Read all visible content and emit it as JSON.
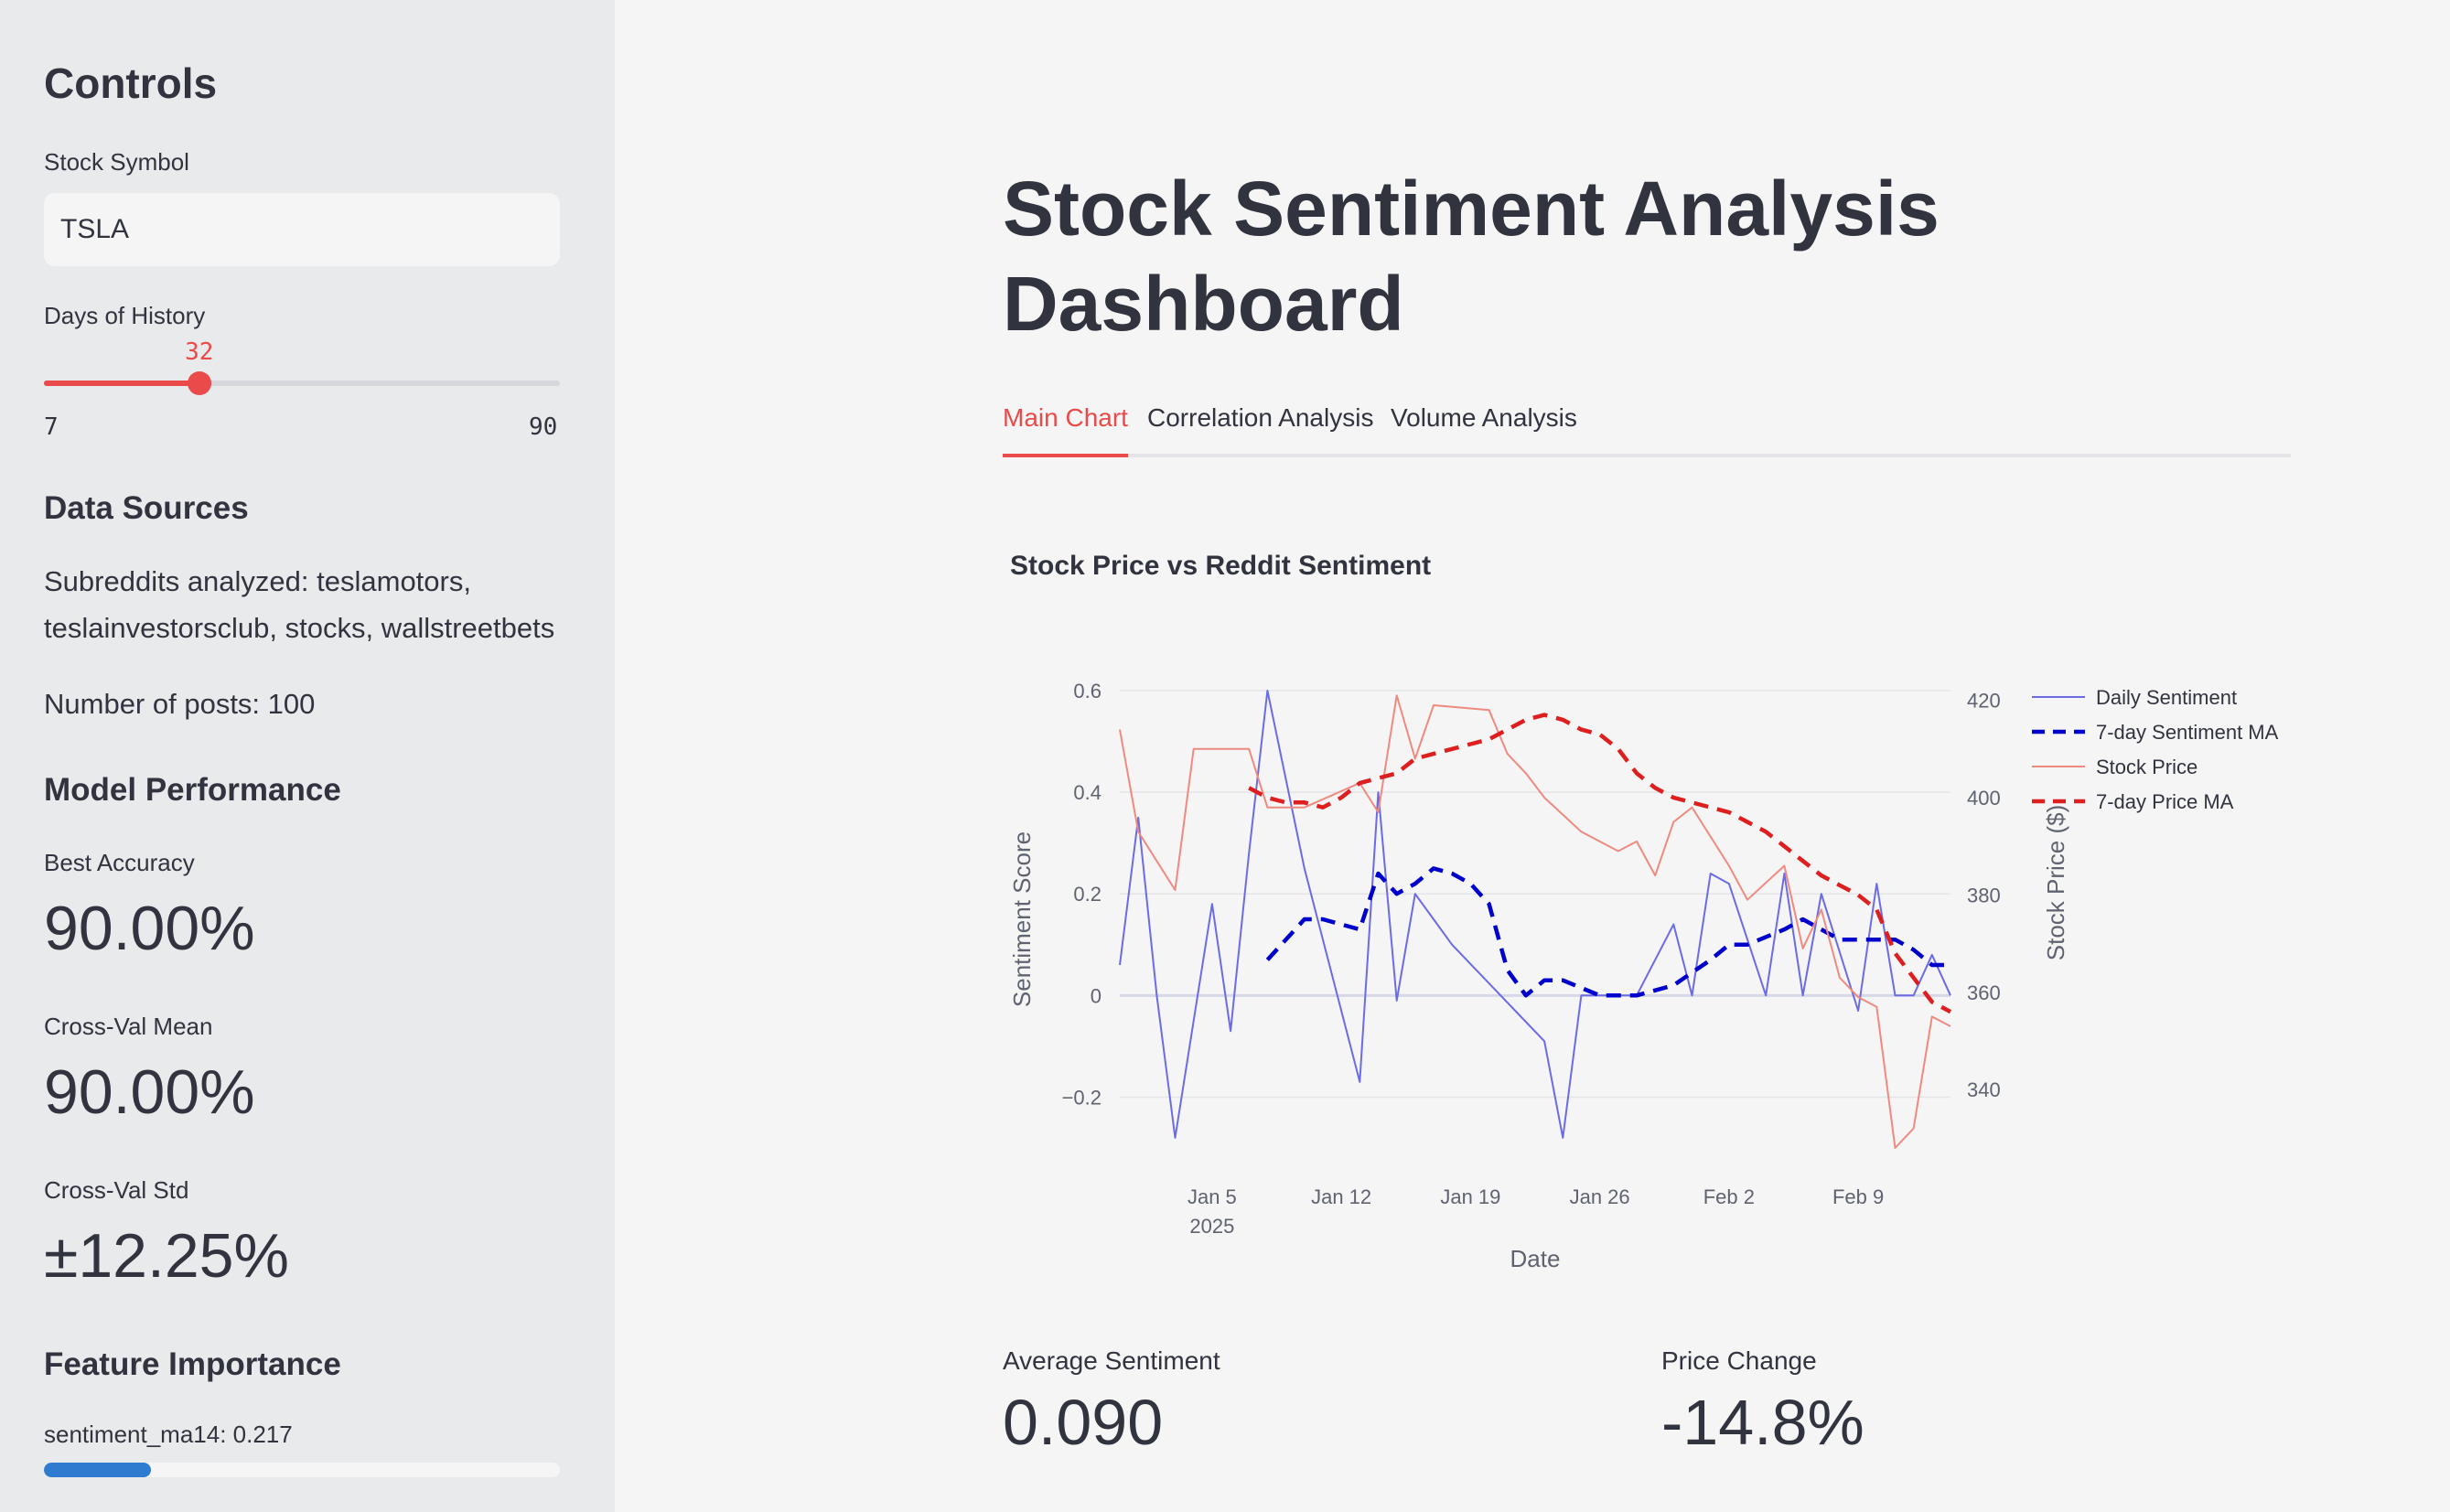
{
  "sidebar": {
    "title": "Controls",
    "stock_symbol_label": "Stock Symbol",
    "stock_symbol_value": "TSLA",
    "days_label": "Days of History",
    "days_value": "32",
    "days_fraction": 0.301,
    "days_min": "7",
    "days_max": "90",
    "data_sources_heading": "Data Sources",
    "subreddits_text": "Subreddits analyzed: teslamotors, teslainvestorsclub, stocks, wallstreetbets",
    "posts_text": "Number of posts: 100",
    "model_heading": "Model Performance",
    "best_accuracy_label": "Best Accuracy",
    "best_accuracy_value": "90.00%",
    "cv_mean_label": "Cross-Val Mean",
    "cv_mean_value": "90.00%",
    "cv_std_label": "Cross-Val Std",
    "cv_std_value": "±12.25%",
    "feature_heading": "Feature Importance",
    "feature_item_label": "sentiment_ma14: 0.217",
    "feature_item_value": 0.217
  },
  "main": {
    "title": "Stock Sentiment Analysis Dashboard",
    "tabs": [
      {
        "label": "Main Chart",
        "active": true
      },
      {
        "label": "Correlation Analysis",
        "active": false
      },
      {
        "label": "Volume Analysis",
        "active": false
      }
    ],
    "chart_title": "Stock Price vs Reddit Sentiment",
    "metrics": [
      {
        "label": "Average Sentiment",
        "value": "0.090"
      },
      {
        "label": "Price Change",
        "value": "-14.8%"
      }
    ]
  },
  "colors": {
    "accent": "#ea4a4a",
    "sentiment": "#6b6be6",
    "sentiment_ma": "#0000cc",
    "price": "#ef8a80",
    "price_ma": "#dd1f1f",
    "feature_bar": "#2e7bcf"
  },
  "chart_data": {
    "type": "line",
    "xlabel": "Date",
    "ylabel": "Sentiment Score",
    "y2label": "Stock Price ($)",
    "xticks": [
      "Jan 5\n2025",
      "Jan 12",
      "Jan 19",
      "Jan 26",
      "Feb 2",
      "Feb 9"
    ],
    "xtick_dates": [
      "2025-01-05",
      "2025-01-12",
      "2025-01-19",
      "2025-01-26",
      "2025-02-02",
      "2025-02-09"
    ],
    "xlim": [
      "2024-12-31",
      "2025-02-14"
    ],
    "ylim": [
      -0.3,
      0.6
    ],
    "yticks": [
      -0.2,
      0,
      0.2,
      0.4,
      0.6
    ],
    "y2lim": [
      328,
      422
    ],
    "y2ticks": [
      340,
      360,
      380,
      400,
      420
    ],
    "legend_position": "top-right",
    "series": [
      {
        "name": "Daily Sentiment",
        "axis": "y",
        "style": "solid",
        "x": [
          "2024-12-31",
          "2025-01-01",
          "2025-01-02",
          "2025-01-03",
          "2025-01-05",
          "2025-01-06",
          "2025-01-07",
          "2025-01-08",
          "2025-01-10",
          "2025-01-13",
          "2025-01-14",
          "2025-01-15",
          "2025-01-16",
          "2025-01-17",
          "2025-01-18",
          "2025-01-23",
          "2025-01-24",
          "2025-01-25",
          "2025-01-26",
          "2025-01-28",
          "2025-01-30",
          "2025-01-31",
          "2025-02-01",
          "2025-02-02",
          "2025-02-04",
          "2025-02-05",
          "2025-02-06",
          "2025-02-07",
          "2025-02-09",
          "2025-02-10",
          "2025-02-11",
          "2025-02-12",
          "2025-02-13",
          "2025-02-14"
        ],
        "y": [
          0.06,
          0.35,
          0.0,
          -0.28,
          0.18,
          -0.07,
          0.28,
          0.6,
          0.25,
          -0.17,
          0.4,
          -0.01,
          0.2,
          0.15,
          0.1,
          -0.09,
          -0.28,
          0.0,
          0.0,
          0.0,
          0.14,
          0.0,
          0.24,
          0.22,
          0.0,
          0.24,
          0.0,
          0.2,
          -0.03,
          0.22,
          0.0,
          0.0,
          0.08,
          0.0
        ]
      },
      {
        "name": "7-day Sentiment MA",
        "axis": "y",
        "style": "dash",
        "x": [
          "2025-01-08",
          "2025-01-10",
          "2025-01-11",
          "2025-01-12",
          "2025-01-13",
          "2025-01-14",
          "2025-01-15",
          "2025-01-16",
          "2025-01-17",
          "2025-01-18",
          "2025-01-19",
          "2025-01-20",
          "2025-01-21",
          "2025-01-22",
          "2025-01-23",
          "2025-01-24",
          "2025-01-26",
          "2025-01-28",
          "2025-01-30",
          "2025-02-01",
          "2025-02-02",
          "2025-02-03",
          "2025-02-05",
          "2025-02-06",
          "2025-02-07",
          "2025-02-08",
          "2025-02-09",
          "2025-02-10",
          "2025-02-11",
          "2025-02-12",
          "2025-02-13",
          "2025-02-14"
        ],
        "y": [
          0.07,
          0.15,
          0.15,
          0.14,
          0.13,
          0.24,
          0.2,
          0.22,
          0.25,
          0.24,
          0.22,
          0.18,
          0.05,
          0.0,
          0.03,
          0.03,
          0.0,
          0.0,
          0.02,
          0.07,
          0.1,
          0.1,
          0.13,
          0.15,
          0.13,
          0.11,
          0.11,
          0.11,
          0.11,
          0.09,
          0.06,
          0.06
        ]
      },
      {
        "name": "Stock Price",
        "axis": "y2",
        "style": "solid",
        "x": [
          "2024-12-31",
          "2025-01-01",
          "2025-01-03",
          "2025-01-04",
          "2025-01-07",
          "2025-01-08",
          "2025-01-10",
          "2025-01-13",
          "2025-01-14",
          "2025-01-15",
          "2025-01-16",
          "2025-01-17",
          "2025-01-20",
          "2025-01-21",
          "2025-01-22",
          "2025-01-23",
          "2025-01-25",
          "2025-01-27",
          "2025-01-28",
          "2025-01-29",
          "2025-01-30",
          "2025-01-31",
          "2025-02-02",
          "2025-02-03",
          "2025-02-05",
          "2025-02-06",
          "2025-02-07",
          "2025-02-08",
          "2025-02-09",
          "2025-02-10",
          "2025-02-11",
          "2025-02-12",
          "2025-02-13",
          "2025-02-14"
        ],
        "y": [
          414,
          393,
          381,
          410,
          410,
          398,
          398,
          403,
          397,
          421,
          408,
          419,
          418,
          409,
          405,
          400,
          393,
          389,
          391,
          384,
          395,
          398,
          386,
          379,
          386,
          369,
          377,
          363,
          359,
          357,
          328,
          332,
          355,
          353
        ]
      },
      {
        "name": "7-day Price MA",
        "axis": "y2",
        "style": "dash",
        "x": [
          "2025-01-07",
          "2025-01-08",
          "2025-01-09",
          "2025-01-10",
          "2025-01-11",
          "2025-01-12",
          "2025-01-13",
          "2025-01-14",
          "2025-01-15",
          "2025-01-16",
          "2025-01-17",
          "2025-01-18",
          "2025-01-19",
          "2025-01-20",
          "2025-01-21",
          "2025-01-22",
          "2025-01-23",
          "2025-01-24",
          "2025-01-25",
          "2025-01-26",
          "2025-01-27",
          "2025-01-28",
          "2025-01-29",
          "2025-01-30",
          "2025-01-31",
          "2025-02-01",
          "2025-02-02",
          "2025-02-03",
          "2025-02-04",
          "2025-02-05",
          "2025-02-06",
          "2025-02-07",
          "2025-02-08",
          "2025-02-09",
          "2025-02-10",
          "2025-02-11",
          "2025-02-12",
          "2025-02-13",
          "2025-02-14"
        ],
        "y": [
          402,
          400,
          399,
          399,
          398,
          400,
          403,
          404,
          405,
          408,
          409,
          410,
          411,
          412,
          414,
          416,
          417,
          416,
          414,
          413,
          410,
          405,
          402,
          400,
          399,
          398,
          397,
          395,
          393,
          390,
          387,
          384,
          382,
          380,
          377,
          368,
          363,
          358,
          356
        ]
      }
    ]
  }
}
